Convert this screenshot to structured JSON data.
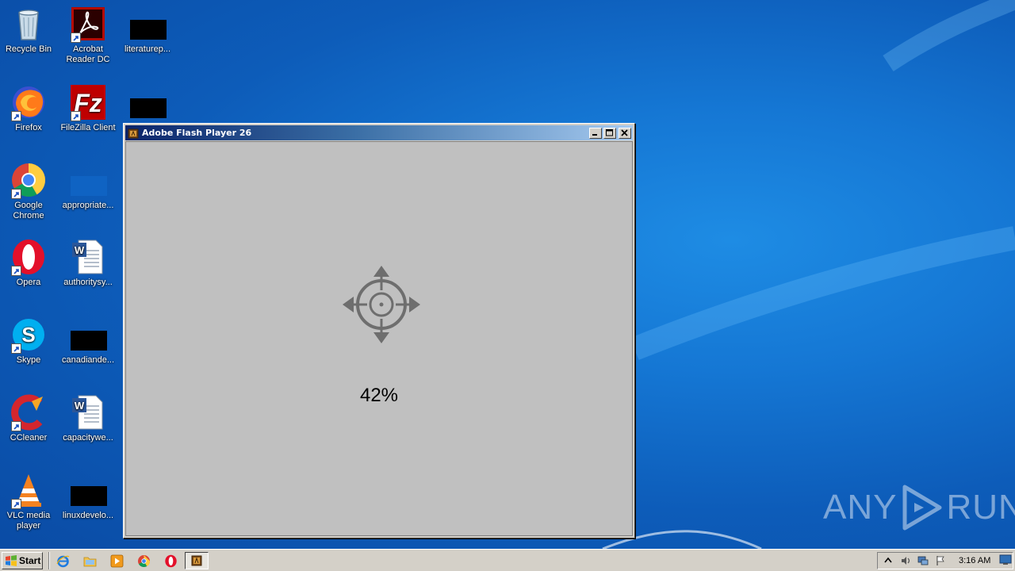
{
  "desktop": {
    "icons": [
      {
        "label": "Recycle Bin"
      },
      {
        "label": "Acrobat Reader DC"
      },
      {
        "label": "literaturep..."
      },
      {
        "label": "Firefox"
      },
      {
        "label": "FileZilla Client"
      },
      {
        "label": "Google Chrome"
      },
      {
        "label": "appropriate..."
      },
      {
        "label": "Opera"
      },
      {
        "label": "authoritysy..."
      },
      {
        "label": "Skype"
      },
      {
        "label": "canadiande..."
      },
      {
        "label": "CCleaner"
      },
      {
        "label": "capacitywe..."
      },
      {
        "label": "VLC media player"
      },
      {
        "label": "linuxdevelo..."
      }
    ]
  },
  "window": {
    "title": "Adobe Flash Player 26",
    "progress_text": "42%",
    "progress_value": 42
  },
  "watermark": {
    "left_text": "ANY",
    "right_text": "RUN"
  },
  "taskbar": {
    "start_label": "Start",
    "clock": "3:16 AM"
  },
  "colors": {
    "titlebar_start": "#0a246a",
    "titlebar_end": "#a6caf0",
    "flash_bg": "#c0c0c0",
    "crosshair": "#6e6e6e",
    "desktop_blue": "#1577d4"
  }
}
